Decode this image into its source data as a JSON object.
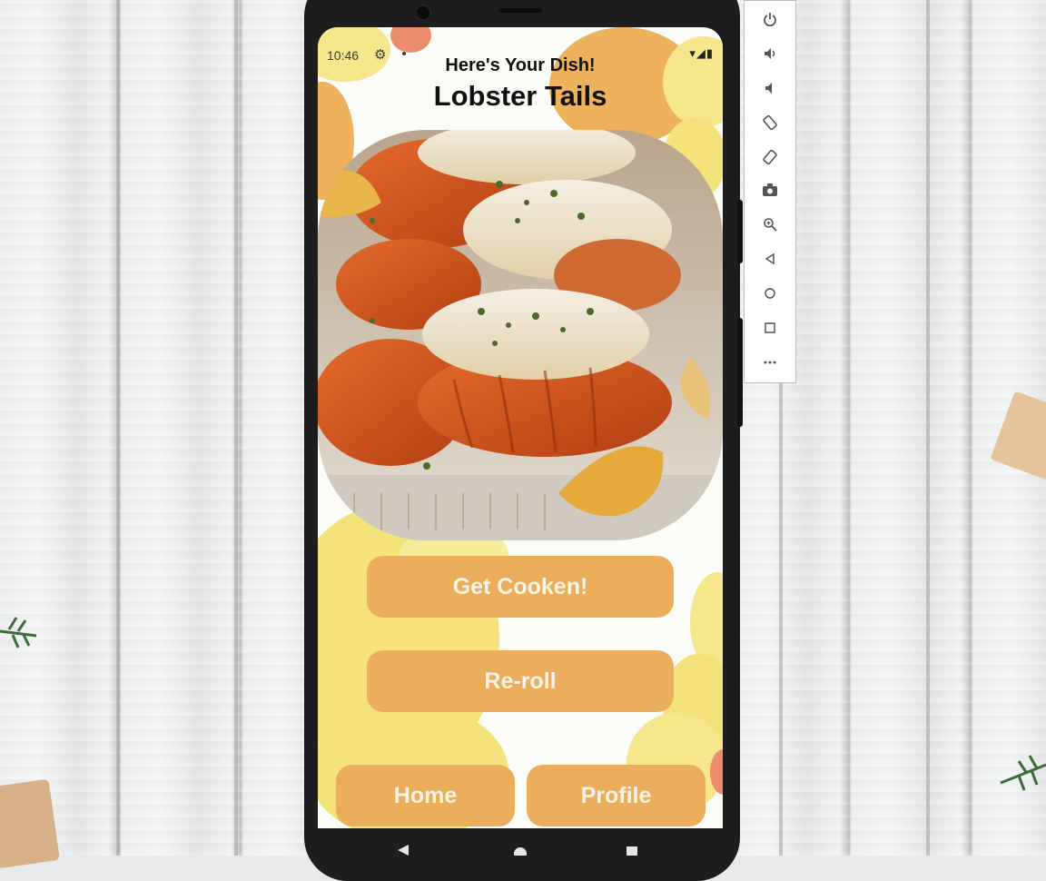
{
  "status_bar": {
    "time": "10:46",
    "settings_icon": "gear-icon",
    "system_icons": "▾◢▮"
  },
  "screen": {
    "subtitle": "Here's Your Dish!",
    "title": "Lobster Tails",
    "image_name": "lobster-tails-photo"
  },
  "buttons": {
    "get_cooking": "Get Cooken!",
    "reroll": "Re-roll",
    "home": "Home",
    "profile": "Profile"
  },
  "emulator_toolbar": [
    "power-icon",
    "volume-up-icon",
    "volume-down-icon",
    "rotate-left-icon",
    "rotate-right-icon",
    "camera-icon",
    "zoom-icon",
    "back-icon",
    "home-icon",
    "overview-icon",
    "more-icon"
  ],
  "colors": {
    "button": "#eaae5c",
    "bubble_orange": "#eeb25c",
    "bubble_yellow": "#f4e27a"
  }
}
